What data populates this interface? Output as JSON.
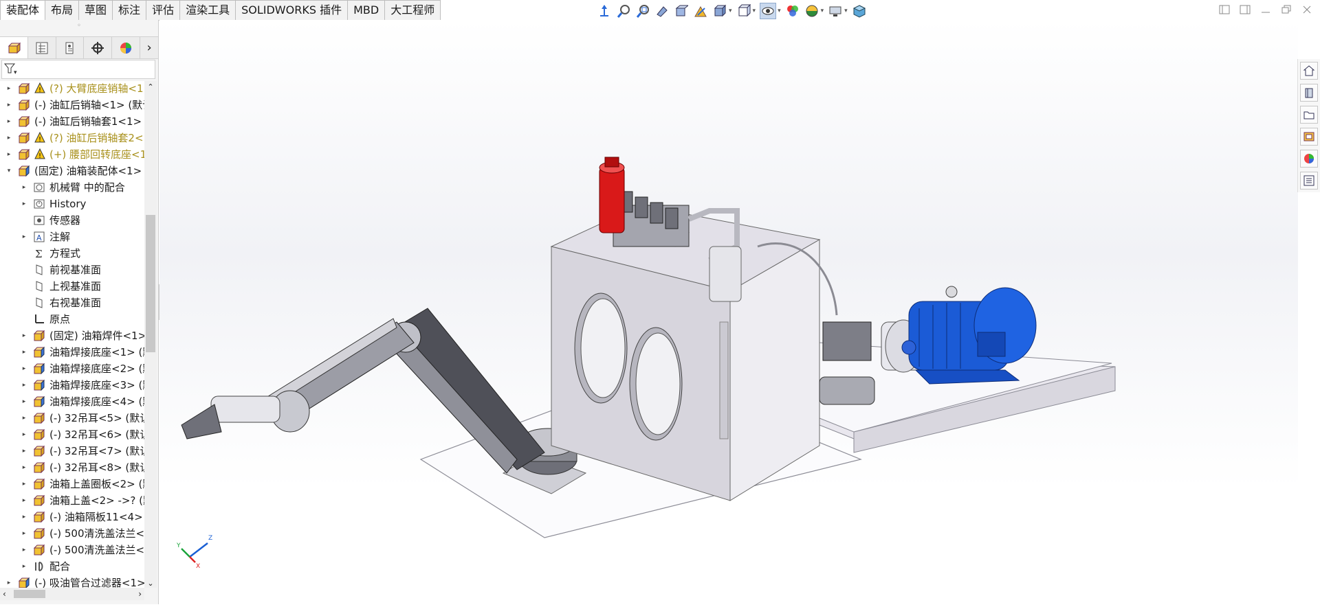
{
  "command_tabs": [
    {
      "label": "装配体",
      "active": true
    },
    {
      "label": "布局"
    },
    {
      "label": "草图"
    },
    {
      "label": "标注"
    },
    {
      "label": "评估"
    },
    {
      "label": "渲染工具"
    },
    {
      "label": "SOLIDWORKS 插件"
    },
    {
      "label": "MBD"
    },
    {
      "label": "大工程师"
    }
  ],
  "heads_up_toolbar": [
    "move-icon",
    "zoom-to-fit-icon",
    "zoom-to-area-icon",
    "previous-view-icon",
    "section-view-icon",
    "dynamic-annotation-icon",
    "view-orientation-icon",
    "display-style-icon",
    "hide-show-items-icon",
    "edit-appearance-icon",
    "apply-scene-icon",
    "view-settings-icon",
    "3d-view-icon"
  ],
  "feature_manager_tabs": [
    "featuremanager-tree-icon",
    "property-manager-icon",
    "configuration-manager-icon",
    "dimxpert-icon",
    "display-manager-icon"
  ],
  "tree_rows": [
    {
      "level": 0,
      "expand": "▸",
      "label": "(?) 大臂底座销轴<1>",
      "warn": true,
      "icon": "part"
    },
    {
      "level": 0,
      "expand": "▸",
      "label": "(-) 油缸后销轴<1> (默认",
      "icon": "part"
    },
    {
      "level": 0,
      "expand": "▸",
      "label": "(-) 油缸后销轴套1<1> (",
      "icon": "part"
    },
    {
      "level": 0,
      "expand": "▸",
      "label": "(?) 油缸后销轴套2<",
      "warn": true,
      "icon": "part"
    },
    {
      "level": 0,
      "expand": "▸",
      "label": "(+) 腰部回转底座<1",
      "warn": true,
      "icon": "part"
    },
    {
      "level": 0,
      "expand": "▾",
      "label": "(固定) 油箱装配体<1> (",
      "icon": "assembly"
    },
    {
      "level": 1,
      "expand": "▸",
      "label": "机械臂 中的配合",
      "icon": "folder"
    },
    {
      "level": 1,
      "expand": "▸",
      "label": "History",
      "icon": "history"
    },
    {
      "level": 1,
      "expand": "",
      "label": "传感器",
      "icon": "sensor"
    },
    {
      "level": 1,
      "expand": "▸",
      "label": "注解",
      "icon": "annotation"
    },
    {
      "level": 1,
      "expand": "",
      "label": "方程式",
      "icon": "equation"
    },
    {
      "level": 1,
      "expand": "",
      "label": "前视基准面",
      "icon": "plane"
    },
    {
      "level": 1,
      "expand": "",
      "label": "上视基准面",
      "icon": "plane"
    },
    {
      "level": 1,
      "expand": "",
      "label": "右视基准面",
      "icon": "plane"
    },
    {
      "level": 1,
      "expand": "",
      "label": "原点",
      "icon": "origin"
    },
    {
      "level": 1,
      "expand": "▸",
      "label": "(固定) 油箱焊件<1>",
      "icon": "part"
    },
    {
      "level": 1,
      "expand": "▸",
      "label": "油箱焊接底座<1> (默",
      "icon": "assembly"
    },
    {
      "level": 1,
      "expand": "▸",
      "label": "油箱焊接底座<2> (默",
      "icon": "assembly"
    },
    {
      "level": 1,
      "expand": "▸",
      "label": "油箱焊接底座<3> (默",
      "icon": "assembly"
    },
    {
      "level": 1,
      "expand": "▸",
      "label": "油箱焊接底座<4> (默",
      "icon": "assembly"
    },
    {
      "level": 1,
      "expand": "▸",
      "label": "(-) 32吊耳<5> (默认",
      "icon": "part"
    },
    {
      "level": 1,
      "expand": "▸",
      "label": "(-) 32吊耳<6> (默认",
      "icon": "part"
    },
    {
      "level": 1,
      "expand": "▸",
      "label": "(-) 32吊耳<7> (默认",
      "icon": "part"
    },
    {
      "level": 1,
      "expand": "▸",
      "label": "(-) 32吊耳<8> (默认",
      "icon": "part"
    },
    {
      "level": 1,
      "expand": "▸",
      "label": "油箱上盖圈板<2> (默",
      "icon": "part"
    },
    {
      "level": 1,
      "expand": "▸",
      "label": "油箱上盖<2> ->? (默",
      "icon": "part"
    },
    {
      "level": 1,
      "expand": "▸",
      "label": "(-) 油箱隔板11<4> (",
      "icon": "part"
    },
    {
      "level": 1,
      "expand": "▸",
      "label": "(-) 500清洗盖法兰<",
      "icon": "part"
    },
    {
      "level": 1,
      "expand": "▸",
      "label": "(-) 500清洗盖法兰<",
      "icon": "part"
    },
    {
      "level": 1,
      "expand": "▸",
      "label": "配合",
      "icon": "mates"
    },
    {
      "level": 0,
      "expand": "▸",
      "label": "(-) 吸油管合过滤器<1>",
      "icon": "assembly"
    }
  ],
  "triad": {
    "x": "X",
    "y": "Y",
    "z": "Z"
  },
  "task_pane": [
    "home-icon",
    "design-library-icon",
    "file-explorer-icon",
    "view-palette-icon",
    "appearances-icon",
    "custom-properties-icon"
  ],
  "colors": {
    "accent_blue": "#1a5fd4",
    "motor_blue": "#1b5bd6",
    "red_filter": "#d91919",
    "warning_text": "#a8901b"
  }
}
